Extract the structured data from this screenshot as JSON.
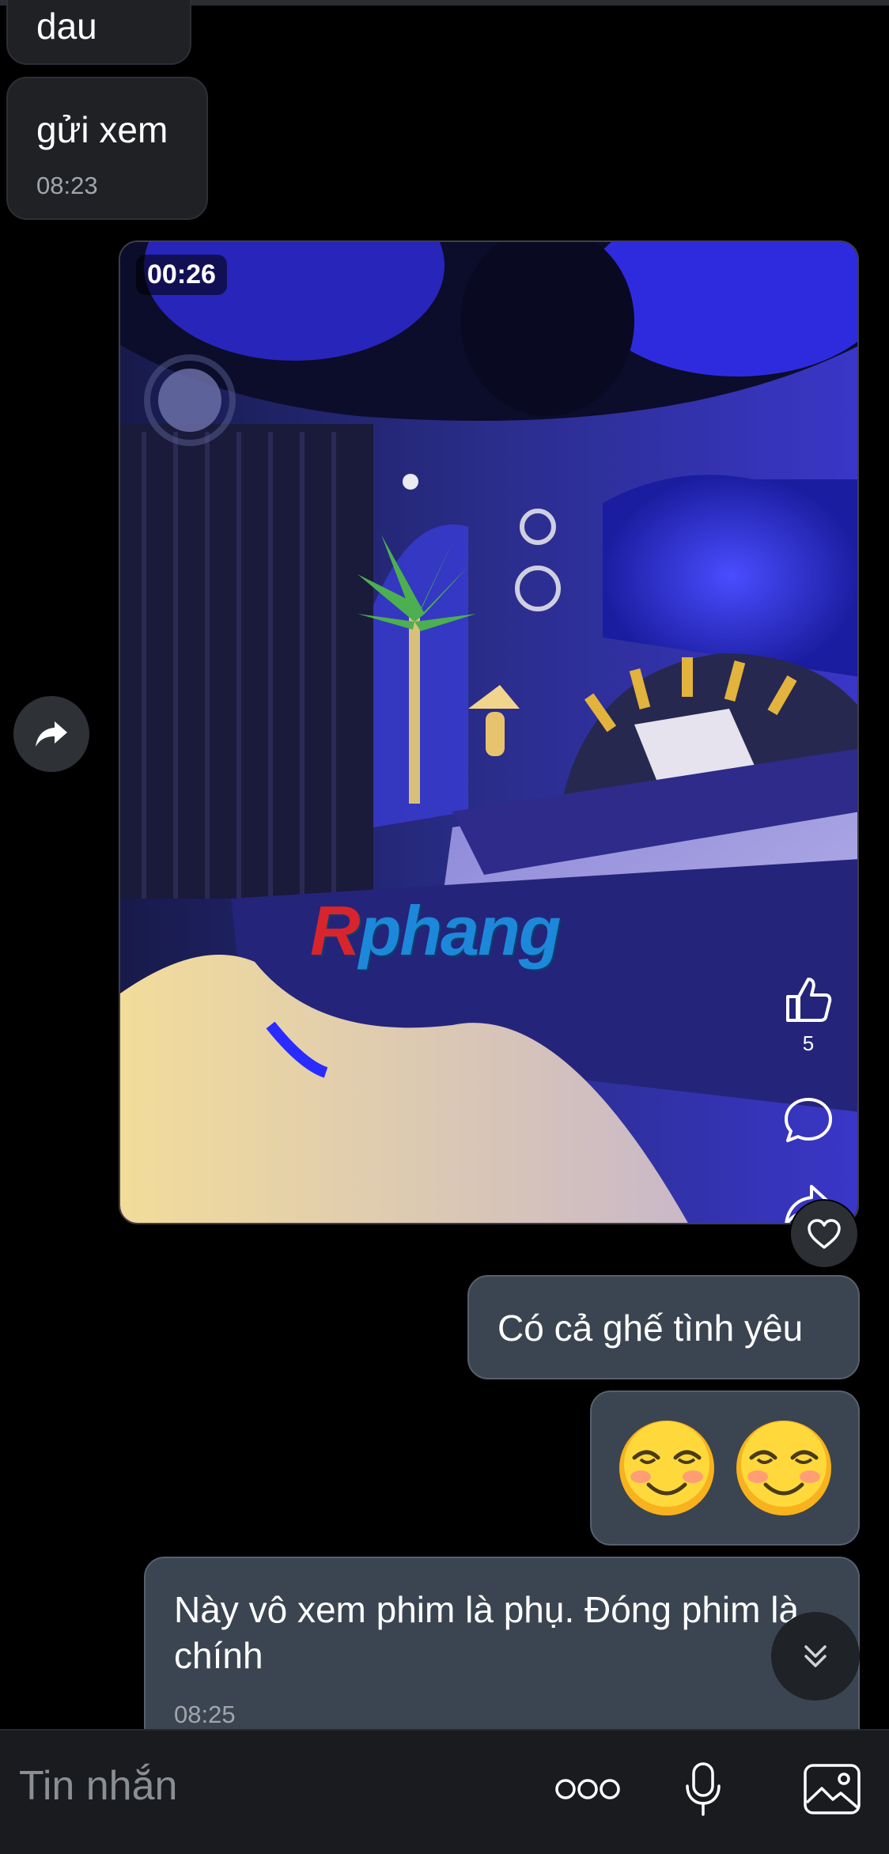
{
  "messages": {
    "top_partial": {
      "text": "dau"
    },
    "gui_xem": {
      "text": "gửi xem",
      "time": "08:23"
    },
    "video": {
      "duration": "00:26",
      "watermark_first": "R",
      "watermark_rest": "phang",
      "like_count": "5"
    },
    "love_seat": {
      "text": "Có cả ghế tình yêu"
    },
    "emoji": {
      "icons": [
        "smiling-face-icon",
        "smiling-face-icon"
      ]
    },
    "movie": {
      "text": "Này vô xem phim là phụ. Đóng phim là chính",
      "time": "08:25"
    }
  },
  "input": {
    "placeholder": "Tin nhắn"
  },
  "icons": {
    "forward": "forward-share-icon",
    "heart": "heart-icon",
    "scroll": "chevron-double-down-icon",
    "more": "more-dots-icon",
    "mic": "microphone-icon",
    "image": "image-gallery-icon"
  },
  "colors": {
    "background": "#000000",
    "incoming_bubble": "#1f2125",
    "outgoing_bubble": "#3b4551",
    "timestamp": "#a0a6ad",
    "input_bar": "#1a1b1e"
  }
}
